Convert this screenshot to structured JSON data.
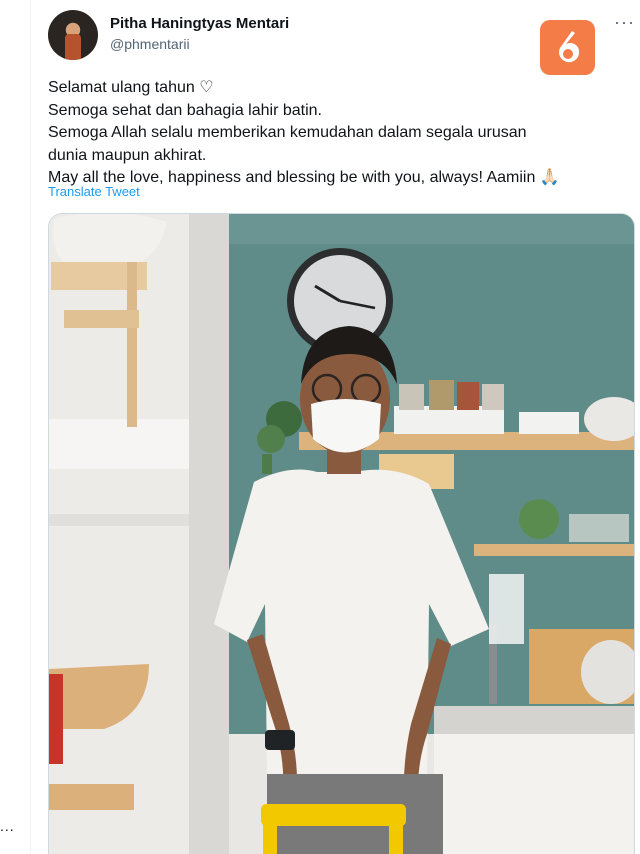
{
  "author": {
    "name": "Pitha Haningtyas Mentari",
    "handle": "@phmentarii"
  },
  "tweet": {
    "lines": [
      "Selamat ulang tahun ♡",
      "Semoga sehat dan bahagia lahir batin.",
      "Semoga Allah selalu memberikan kemudahan dalam segala urusan",
      "dunia maupun akhirat.",
      "May all the love, happiness and blessing be with you, always! Aamiin 🙏🏻"
    ],
    "translate_label": "Translate Tweet"
  },
  "more_label": "···",
  "left_more_label": "...",
  "watermark": {
    "text": "6",
    "color": "#f47d47"
  },
  "colors": {
    "link": "#1d9bf0",
    "secondary": "#536471",
    "wall_teal": "#5f8c89"
  }
}
